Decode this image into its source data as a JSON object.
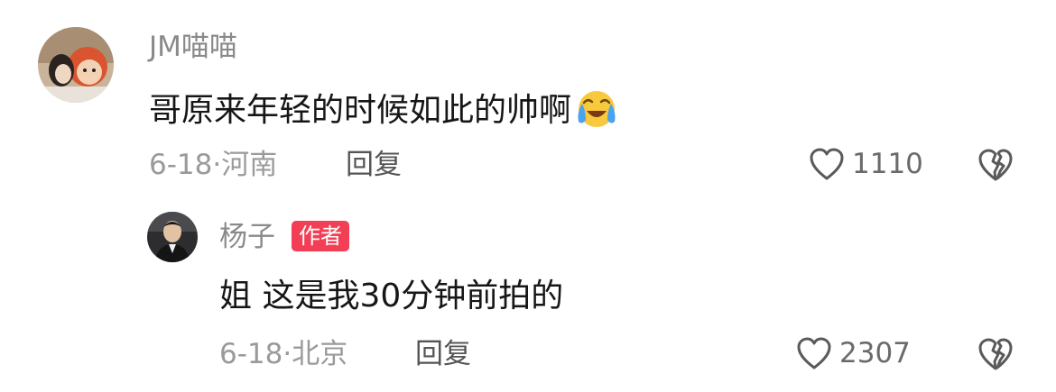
{
  "comments": [
    {
      "username": "JM喵喵",
      "text": "哥原来年轻的时候如此的帅啊",
      "emoji_icon": "crying-laughing-emoji-icon",
      "date": "6-18",
      "location": "河南",
      "reply_label": "回复",
      "like_count": "1110",
      "like_icon": "heart-outline-icon",
      "dislike_icon": "broken-heart-icon"
    },
    {
      "username": "杨子",
      "badge": "作者",
      "badge_color": "#f23f55",
      "text": "姐 这是我30分钟前拍的",
      "date": "6-18",
      "location": "北京",
      "reply_label": "回复",
      "like_count": "2307",
      "like_icon": "heart-outline-icon",
      "dislike_icon": "broken-heart-icon"
    }
  ],
  "separator": "·"
}
